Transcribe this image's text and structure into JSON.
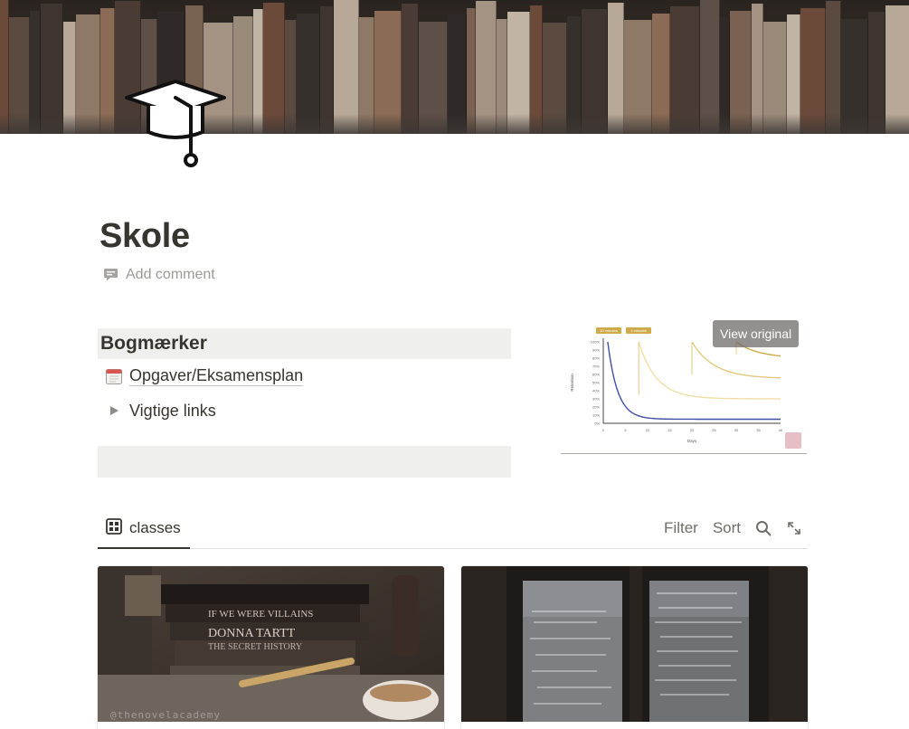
{
  "page": {
    "title": "Skole",
    "comment_label": "Add comment",
    "cover_icon": "books-shelf-cover",
    "page_icon": "graduation-cap-icon"
  },
  "bookmarks": {
    "heading": "Bogmærker",
    "items": [
      {
        "label": "Opgaver/Eksamensplan",
        "icon": "calendar-icon"
      },
      {
        "label": "Vigtige links",
        "icon": "toggle-triangle-icon"
      }
    ]
  },
  "embed": {
    "view_original_label": "View original",
    "chart_description_icon": "forgetting-curve-image",
    "chart_data": {
      "type": "line",
      "xlabel": "Days",
      "ylabel": "Retention",
      "x_ticks": [
        "0",
        "5",
        "10",
        "15",
        "20",
        "25",
        "30",
        "35",
        "40"
      ],
      "y_ticks": [
        "0%",
        "10%",
        "20%",
        "30%",
        "40%",
        "50%",
        "60%",
        "70%",
        "80%",
        "90%",
        "100%"
      ],
      "annotations": [
        "10 minutes",
        "1 minutes"
      ],
      "series_colors": [
        "#3f4fa3",
        "#f0dea8",
        "#e3c97c",
        "#cfaa4a"
      ]
    }
  },
  "database": {
    "view_tab_label": "classes",
    "view_icon": "gallery-icon",
    "actions": {
      "filter": "Filter",
      "sort": "Sort"
    },
    "search_icon": "search-icon",
    "expand_icon": "expand-icon",
    "cards": [
      {
        "cover": "donna-tartt-books-photo",
        "watermark": "@thenovelacademy"
      },
      {
        "cover": "window-equations-photo"
      }
    ]
  },
  "colors": {
    "text": "#37352f",
    "muted": "#9b9a97",
    "block_bg": "#efefed",
    "chart_gold": "#cfaa4a",
    "chart_blue": "#3f4fa3"
  }
}
